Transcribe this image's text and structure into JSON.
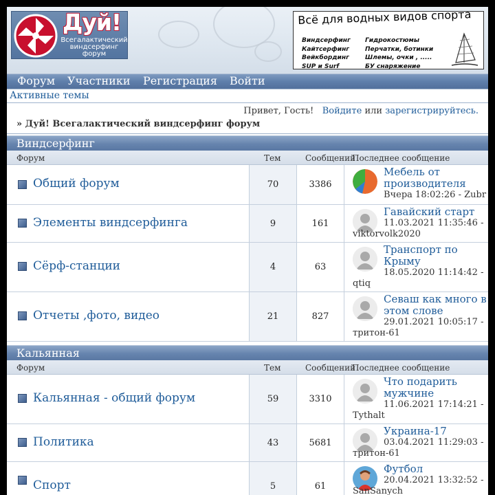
{
  "header": {
    "logo_title": "Дуй!",
    "logo_subtitle": [
      "Всегалактический",
      "виндсерфинг",
      "форум"
    ],
    "ad": {
      "title": "Всё для водных видов спорта",
      "col1": [
        "Виндсерфинг",
        "Кайтсерфинг",
        "Вейкбординг",
        "SUP и Surf"
      ],
      "col2": [
        "Гидрокостюмы",
        "Перчатки, ботинки",
        "Шлемы, очки , .....",
        "БУ  снаряжение"
      ]
    }
  },
  "nav": [
    {
      "label": "Форум"
    },
    {
      "label": "Участники"
    },
    {
      "label": "Регистрация"
    },
    {
      "label": "Войти"
    }
  ],
  "active_topics": "Активные темы",
  "welcome": {
    "greeting": "Привет, Гость!",
    "login": "Войдите",
    "or": "или",
    "register": "зарегистрируйтесь."
  },
  "breadcrumb": "» Дуй! Всегалактический виндсерфинг форум",
  "columns": {
    "forum": "Форум",
    "topics": "Тем",
    "messages": "Сообщений",
    "last": "Последнее сообщение"
  },
  "categories": [
    {
      "title": "Виндсерфинг",
      "forums": [
        {
          "name": "Общий форум",
          "topics": "70",
          "messages": "3386",
          "last_title": "Мебель от производителя",
          "last_time": "Вчера 18:02:26 - Zubr",
          "avatar": "pie"
        },
        {
          "name": "Элементы виндсерфинга",
          "topics": "9",
          "messages": "161",
          "last_title": "Гавайский старт",
          "last_time": "11.03.2021 11:35:46 -",
          "last_user": "viktorvolk2020",
          "avatar": "default"
        },
        {
          "name": "Сёрф-станции",
          "topics": "4",
          "messages": "63",
          "last_title": "Транспорт по Крыму",
          "last_time": "18.05.2020 11:14:42 -",
          "last_user": "qtiq",
          "avatar": "default"
        },
        {
          "name": "Отчеты ,фото, видео",
          "topics": "21",
          "messages": "827",
          "last_title": "Севаш как много в этом слове",
          "last_time": "29.01.2021 10:05:17 -",
          "last_user": "тритон-61",
          "avatar": "default"
        }
      ]
    },
    {
      "title": "Кальянная",
      "forums": [
        {
          "name": "Кальянная - общий форум",
          "topics": "59",
          "messages": "3310",
          "last_title": "Что подарить мужчине",
          "last_time": "11.06.2021 17:14:21 -",
          "last_user": "Tythalt",
          "avatar": "default"
        },
        {
          "name": "Политика",
          "topics": "43",
          "messages": "5681",
          "last_title": "Украина-17",
          "last_time": "03.04.2021 11:29:03 -",
          "last_user": "тритон-61",
          "avatar": "default"
        },
        {
          "name": "Спорт",
          "topics": "5",
          "messages": "61",
          "last_title": "Футбол",
          "last_time": "20.04.2021 13:32:52 -",
          "last_user": "SanSanych",
          "avatar": "photo"
        }
      ]
    }
  ],
  "colors": {
    "link": "#1f5c99",
    "bar": "#5f7fab"
  }
}
